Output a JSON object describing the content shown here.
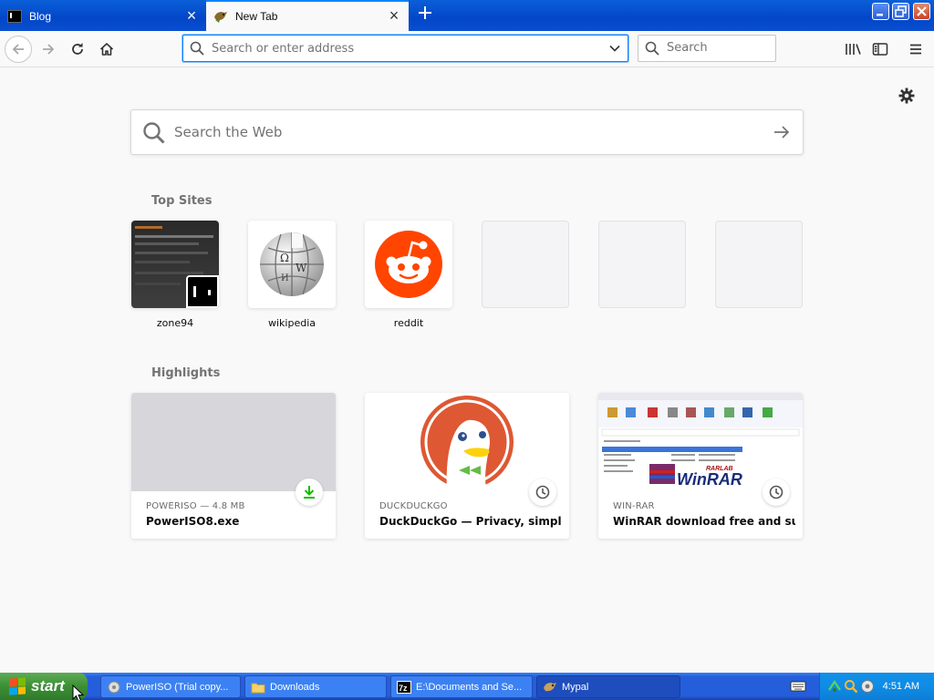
{
  "tabs": [
    {
      "title": "Blog",
      "active": false
    },
    {
      "title": "New Tab",
      "active": true
    }
  ],
  "navbar": {
    "url_placeholder": "Search or enter address",
    "search_placeholder": "Search"
  },
  "newtab": {
    "web_search_placeholder": "Search the Web",
    "top_sites_title": "Top Sites",
    "top_sites": [
      "zone94",
      "wikipedia",
      "reddit"
    ],
    "highlights_title": "Highlights",
    "highlights": [
      {
        "meta": "POWERISO — 4.8 MB",
        "name": "PowerISO8.exe",
        "badge": "download-icon"
      },
      {
        "meta": "DUCKDUCKGO",
        "name": "DuckDuckGo — Privacy, simplifi...",
        "badge": "clock-icon"
      },
      {
        "meta": "WIN-RAR",
        "name": "WinRAR download free and sup...",
        "badge": "clock-icon"
      }
    ]
  },
  "taskbar": {
    "start_label": "start",
    "tasks": [
      {
        "label": "PowerISO (Trial copy...",
        "icon": "poweriso-icon"
      },
      {
        "label": "Downloads",
        "icon": "folder-icon"
      },
      {
        "label": "E:\\Documents and Se...",
        "icon": "7zip-icon"
      },
      {
        "label": "Mypal",
        "icon": "mypal-icon"
      }
    ],
    "clock": "4:51 AM"
  },
  "colors": {
    "accent": "#0a84ff",
    "reddit": "#ff4500",
    "duckduckgo": "#de5833",
    "download_green": "#12bc00"
  }
}
